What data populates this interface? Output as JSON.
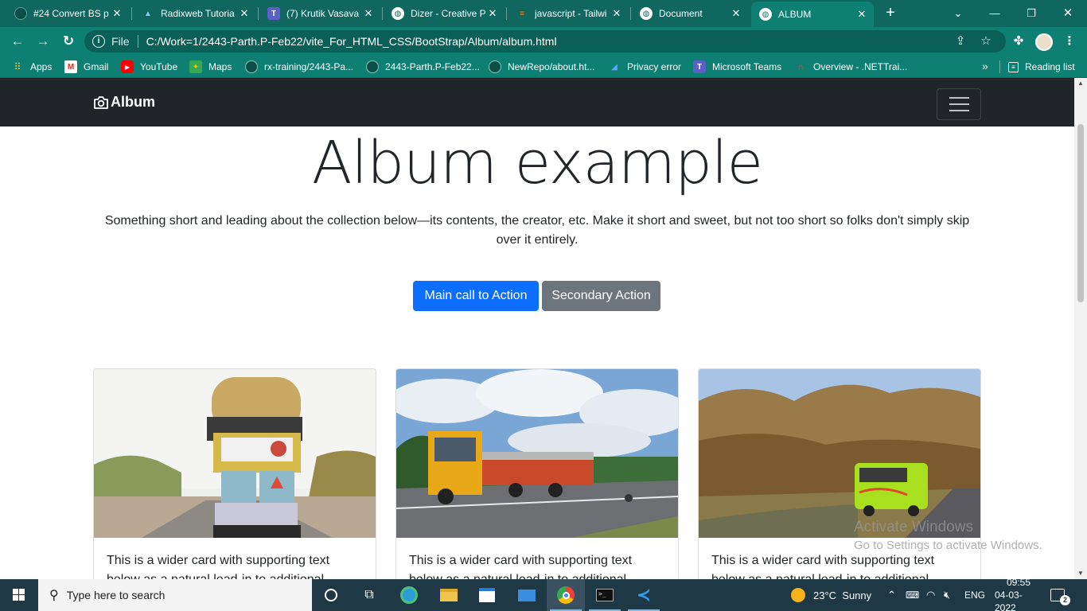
{
  "browser": {
    "tabs": [
      {
        "title": "#24 Convert BS p",
        "icon": "github-icon",
        "active": false
      },
      {
        "title": "Radixweb Tutoria",
        "icon": "radixweb-icon",
        "active": false
      },
      {
        "title": "(7) Krutik Vasava",
        "icon": "teams-icon",
        "active": false
      },
      {
        "title": "Dizer - Creative P",
        "icon": "globe-icon",
        "active": false
      },
      {
        "title": "javascript - Tailwi",
        "icon": "stackoverflow-icon",
        "active": false
      },
      {
        "title": "Document",
        "icon": "globe-icon",
        "active": false
      },
      {
        "title": "ALBUM",
        "icon": "globe-icon",
        "active": true
      }
    ],
    "address": {
      "scheme_label": "File",
      "url": "C:/Work=1/2443-Parth.P-Feb22/vite_For_HTML_CSS/BootStrap/Album/album.html"
    },
    "bookmarks": [
      {
        "label": "Apps",
        "icon": "apps-grid-icon"
      },
      {
        "label": "Gmail",
        "icon": "gmail-icon"
      },
      {
        "label": "YouTube",
        "icon": "youtube-icon"
      },
      {
        "label": "Maps",
        "icon": "maps-icon"
      },
      {
        "label": "rx-training/2443-Pa...",
        "icon": "github-icon"
      },
      {
        "label": "2443-Parth.P-Feb22...",
        "icon": "github-icon"
      },
      {
        "label": "NewRepo/about.ht...",
        "icon": "github-icon"
      },
      {
        "label": "Privacy error",
        "icon": "azure-icon"
      },
      {
        "label": "Microsoft Teams",
        "icon": "teams-icon"
      },
      {
        "label": "Overview - .NETTrai...",
        "icon": "overview-icon"
      }
    ],
    "bookmarks_more": "»",
    "reading_list": "Reading list"
  },
  "page": {
    "brand": "Album",
    "hero_title": "Album example",
    "hero_lead": "Something short and leading about the collection below—its contents, the creator, etc. Make it short and sweet, but not too short so folks don't simply skip over it entirely.",
    "primary_action": "Main call to Action",
    "secondary_action": "Secondary Action",
    "cards": [
      {
        "text": "This is a wider card with supporting text below as a natural lead-in to additional",
        "image": "decorated-truck-photo"
      },
      {
        "text": "This is a wider card with supporting text below as a natural lead-in to additional",
        "image": "highway-truck-photo"
      },
      {
        "text": "This is a wider card with supporting text below as a natural lead-in to additional",
        "image": "green-bus-photo"
      }
    ],
    "watermark": {
      "line1": "Activate Windows",
      "line2": "Go to Settings to activate Windows."
    }
  },
  "taskbar": {
    "search_placeholder": "Type here to search",
    "weather": "23°C  Sunny",
    "language": "ENG",
    "time": "09:55",
    "date": "04-03-2022",
    "notifications": "2"
  },
  "colors": {
    "chrome_frame": "#10675f",
    "chrome_toolbar": "#0e7f73",
    "site_navbar": "#212529",
    "btn_primary": "#0d6efd",
    "btn_secondary": "#6c757d",
    "taskbar": "#1f3846"
  }
}
